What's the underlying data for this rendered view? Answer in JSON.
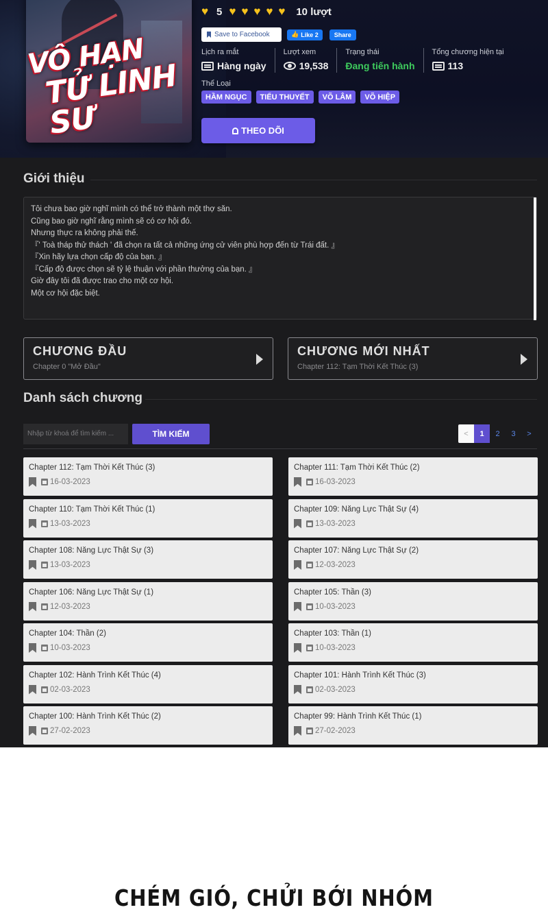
{
  "cover": {
    "title_line1": "VÔ HẠN",
    "title_line2": "TỬ LINH SƯ"
  },
  "rating": {
    "score": "5",
    "count_label": "10 lượt"
  },
  "social": {
    "save_label": "Save to Facebook",
    "like_label": "Like 2",
    "share_label": "Share"
  },
  "stats": [
    {
      "label": "Lịch ra mắt",
      "value": "Hàng ngày",
      "icon": "calendar-icon"
    },
    {
      "label": "Lượt xem",
      "value": "19,538",
      "icon": "eye-icon"
    },
    {
      "label": "Trạng thái",
      "value": "Đang tiến hành",
      "color": "#3ecb5d"
    },
    {
      "label": "Tổng chương hiện tại",
      "value": "113",
      "icon": "list-icon"
    }
  ],
  "genres_label": "Thể Loại",
  "genres": [
    "HẦM NGỤC",
    "TIỂU THUYẾT",
    "VÕ LÂM",
    "VÕ HIỆP"
  ],
  "follow_label": "THEO DÕI",
  "intro": {
    "title": "Giới thiệu",
    "lines": [
      "Tôi chưa bao giờ nghĩ mình có thể trở thành một thợ săn.",
      "Cũng bao giờ nghĩ rằng mình sẽ có cơ hội đó.",
      "Nhưng thực ra không phải thế.",
      "『' Toà tháp thử thách ' đã chọn ra tất cả những ứng cử viên phù hợp đến từ Trái đất. 』",
      "『Xin hãy lựa chọn cấp độ của bạn. 』",
      "『Cấp độ được chọn sẽ tỷ lệ thuận với phần thưởng của bạn. 』",
      "Giờ đây tôi đã được trao cho một cơ hội.",
      "Một cơ hội đặc biệt."
    ]
  },
  "first_chapter": {
    "title": "CHƯƠNG ĐẦU",
    "sub": "Chapter 0 \"Mở Đầu\""
  },
  "latest_chapter": {
    "title": "CHƯƠNG MỚI NHẤT",
    "sub": "Chapter 112: Tạm Thời Kết Thúc (3)"
  },
  "chapter_list": {
    "title": "Danh sách chương",
    "search_placeholder": "Nhập từ khoá để tìm kiếm ...",
    "search_button": "TÌM KIẾM",
    "pages": [
      "<",
      "1",
      "2",
      "3",
      ">"
    ],
    "items": [
      {
        "name": "Chapter 112: Tạm Thời Kết Thúc (3)",
        "date": "16-03-2023"
      },
      {
        "name": "Chapter 111: Tạm Thời Kết Thúc (2)",
        "date": "16-03-2023"
      },
      {
        "name": "Chapter 110: Tạm Thời Kết Thúc (1)",
        "date": "13-03-2023"
      },
      {
        "name": "Chapter 109: Năng Lực Thật Sự (4)",
        "date": "13-03-2023"
      },
      {
        "name": "Chapter 108: Năng Lực Thật Sự (3)",
        "date": "13-03-2023"
      },
      {
        "name": "Chapter 107: Năng Lực Thật Sự (2)",
        "date": "12-03-2023"
      },
      {
        "name": "Chapter 106: Năng Lực Thật Sự (1)",
        "date": "12-03-2023"
      },
      {
        "name": "Chapter 105: Thần (3)",
        "date": "10-03-2023"
      },
      {
        "name": "Chapter 104: Thần (2)",
        "date": "10-03-2023"
      },
      {
        "name": "Chapter 103: Thần (1)",
        "date": "10-03-2023"
      },
      {
        "name": "Chapter 102: Hành Trình Kết Thúc (4)",
        "date": "02-03-2023"
      },
      {
        "name": "Chapter 101: Hành Trình Kết Thúc (3)",
        "date": "02-03-2023"
      },
      {
        "name": "Chapter 100: Hành Trình Kết Thúc (2)",
        "date": "27-02-2023"
      },
      {
        "name": "Chapter 99: Hành Trình Kết Thúc (1)",
        "date": "27-02-2023"
      }
    ]
  },
  "bottom_caption": "CHÉM GIÓ, CHỬI BỚI NHÓM",
  "colors": {
    "accent": "#6c5ce7",
    "status_green": "#3ecb5d",
    "heart": "#f6c21c"
  }
}
